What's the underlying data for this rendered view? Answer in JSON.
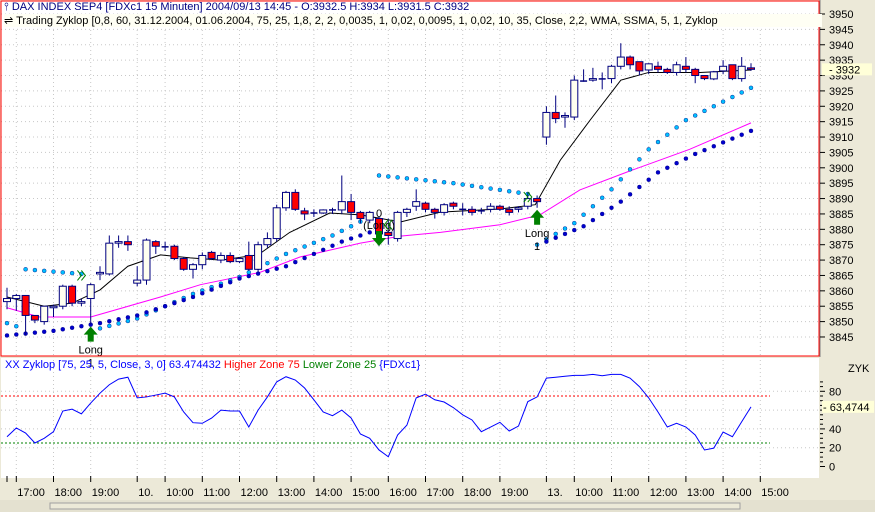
{
  "header": {
    "icon": "candlestick-icon",
    "symbol_line": "DAX INDEX SEP4   [FDXc1  15 Minuten] 2004/09/13 14:45 - O:3932.5 H:3934 L:3931.5 C:3932",
    "indicator_icon": "double-arrow-icon",
    "indicator_line": "Trading Zyklop [0,8, 60, 31.12.2004, 01.06.2004, 75, 25, 1,8, 2, 2, 0,0035, 1, 0,02, 0,0095, 1, 0,02, 10, 35, Close, 2,2, WMA, SSMA, 5, 1, Zyklop"
  },
  "oscillator_header": {
    "name": "XX Zyklop [75, 25, 5, Close, 3, 0] 63.474432",
    "higher": "Higher Zone 75",
    "lower": "Lower Zone 25",
    "symbol": "{FDXc1}"
  },
  "colors": {
    "bull": "#FFFFF0",
    "bear": "#FF0000",
    "outline": "#000080",
    "wma": "#000000",
    "ssma": "#FF00FF",
    "dot_light": "#00BFFF",
    "dot_dark": "#0000CC",
    "signal": "#008000",
    "osc": "#0000FF",
    "grid": "#C8C8C8",
    "frame": "#FF0000"
  },
  "chart_data": [
    {
      "type": "candlestick",
      "title": "DAX INDEX SEP4 [FDXc1 15 Minuten]",
      "ylim": [
        3842,
        3952
      ],
      "y_ticks": [
        3950,
        3945,
        3940,
        3935,
        3930,
        3925,
        3920,
        3915,
        3910,
        3905,
        3900,
        3895,
        3890,
        3885,
        3880,
        3875,
        3870,
        3865,
        3860,
        3855,
        3850,
        3845
      ],
      "last_price": "3932",
      "ohlc": [
        [
          3856.5,
          3861,
          3854,
          3857.5
        ],
        [
          3857.5,
          3859,
          3853.5,
          3858.5
        ],
        [
          3858.5,
          3858.5,
          3845.5,
          3852
        ],
        [
          3852,
          3852,
          3849.5,
          3850.5
        ],
        [
          3850,
          3855,
          3849,
          3855
        ],
        [
          3854.5,
          3855.5,
          3851.5,
          3855
        ],
        [
          3855,
          3862,
          3854,
          3861.5
        ],
        [
          3861.5,
          3862,
          3855,
          3856
        ],
        [
          3856,
          3857.5,
          3855,
          3856.5
        ],
        [
          3857.5,
          3862.5,
          3849,
          3862
        ],
        [
          3865.5,
          3868,
          3863.5,
          3866
        ],
        [
          3865.5,
          3878,
          3865,
          3875.5
        ],
        [
          3875.5,
          3878,
          3874,
          3876
        ],
        [
          3876,
          3878,
          3873,
          3875
        ],
        [
          3862.5,
          3868,
          3861.5,
          3863.5
        ],
        [
          3863.5,
          3877,
          3862,
          3876.5
        ],
        [
          3876,
          3876.5,
          3872,
          3874.5
        ],
        [
          3874.3,
          3876,
          3873,
          3874.3
        ],
        [
          3874.5,
          3875,
          3870,
          3870.5
        ],
        [
          3870.5,
          3871,
          3866.5,
          3867
        ],
        [
          3867,
          3869,
          3864,
          3868.5
        ],
        [
          3868.5,
          3872.5,
          3867,
          3871.5
        ],
        [
          3872.5,
          3873,
          3870,
          3870.5
        ],
        [
          3870,
          3872.5,
          3869,
          3871.5
        ],
        [
          3871.5,
          3872.5,
          3869,
          3869.5
        ],
        [
          3869.5,
          3871,
          3869,
          3870.5
        ],
        [
          3871.5,
          3876,
          3866.5,
          3867
        ],
        [
          3867,
          3876,
          3866,
          3875
        ],
        [
          3875,
          3879,
          3874,
          3877
        ],
        [
          3877,
          3888,
          3876,
          3887
        ],
        [
          3887,
          3892.5,
          3886,
          3892
        ],
        [
          3892,
          3893,
          3886,
          3886.5
        ],
        [
          3886,
          3887,
          3883,
          3885
        ],
        [
          3885.3,
          3886.5,
          3884,
          3885.3
        ],
        [
          3885.3,
          3886.5,
          3885,
          3886.3
        ],
        [
          3886.3,
          3887,
          3885,
          3886.3
        ],
        [
          3886.3,
          3897.5,
          3885,
          3889
        ],
        [
          3889,
          3891.5,
          3883,
          3885.5
        ],
        [
          3885.5,
          3886,
          3882,
          3883.5
        ],
        [
          3883,
          3886,
          3882,
          3885.5
        ],
        [
          3883.5,
          3884,
          3874.5,
          3878.5
        ],
        [
          3879,
          3883.5,
          3875,
          3878
        ],
        [
          3877,
          3886,
          3876,
          3885.5
        ],
        [
          3885.5,
          3887,
          3884,
          3886.5
        ],
        [
          3887.5,
          3893,
          3886,
          3889
        ],
        [
          3888.5,
          3889,
          3885.5,
          3886.5
        ],
        [
          3886.5,
          3887,
          3883.5,
          3885.5
        ],
        [
          3885.5,
          3888.5,
          3884.5,
          3888
        ],
        [
          3888.5,
          3889,
          3886.5,
          3887.5
        ],
        [
          3886.5,
          3888.5,
          3884.5,
          3886.5
        ],
        [
          3886.5,
          3887.5,
          3884.5,
          3885.5
        ],
        [
          3886,
          3887,
          3885,
          3886
        ],
        [
          3886.5,
          3888.5,
          3885.5,
          3887.5
        ],
        [
          3887.5,
          3888,
          3886,
          3886.5
        ],
        [
          3886.5,
          3887.5,
          3884.5,
          3885.5
        ],
        [
          3886.5,
          3887.5,
          3885.5,
          3887
        ],
        [
          3887.5,
          3892,
          3886.5,
          3890
        ],
        [
          3890,
          3891,
          3887,
          3889
        ],
        [
          3910,
          3920,
          3907.5,
          3918
        ],
        [
          3918,
          3923.5,
          3914.5,
          3916
        ],
        [
          3916.5,
          3918,
          3913,
          3917
        ],
        [
          3916.5,
          3930,
          3915.5,
          3928.5
        ],
        [
          3928.2,
          3932,
          3928,
          3928.2
        ],
        [
          3928.5,
          3932.5,
          3928,
          3929
        ],
        [
          3928.9,
          3931,
          3925.5,
          3928.9
        ],
        [
          3929,
          3933.5,
          3927.5,
          3933
        ],
        [
          3933,
          3940.5,
          3932,
          3936
        ],
        [
          3936,
          3936.5,
          3932,
          3933.5
        ],
        [
          3934.5,
          3934.5,
          3930,
          3931.5
        ],
        [
          3931.8,
          3934,
          3930.5,
          3933.8
        ],
        [
          3933,
          3934.5,
          3931,
          3932
        ],
        [
          3932,
          3932.5,
          3930.5,
          3931
        ],
        [
          3931,
          3934.5,
          3930,
          3933.5
        ],
        [
          3933,
          3936,
          3931,
          3932
        ],
        [
          3932,
          3932.5,
          3927.5,
          3930
        ],
        [
          3930,
          3930,
          3928.5,
          3929
        ],
        [
          3928.9,
          3931.5,
          3928.5,
          3931.2
        ],
        [
          3931.5,
          3935,
          3930.5,
          3933
        ],
        [
          3933.5,
          3933.5,
          3928.5,
          3929
        ],
        [
          3929,
          3936,
          3928,
          3933
        ],
        [
          3932.5,
          3934,
          3931.5,
          3932
        ]
      ],
      "wma_line": [
        [
          0,
          3858
        ],
        [
          4,
          3855
        ],
        [
          7,
          3856
        ],
        [
          10,
          3860.3
        ],
        [
          13,
          3868
        ],
        [
          16.5,
          3871.7
        ],
        [
          19.7,
          3870.7
        ],
        [
          23,
          3870
        ],
        [
          27,
          3871.7
        ],
        [
          30.4,
          3879
        ],
        [
          34.7,
          3885.3
        ],
        [
          38,
          3884.7
        ],
        [
          42.3,
          3882.4
        ],
        [
          46.6,
          3885.6
        ],
        [
          53,
          3886.6
        ],
        [
          56.8,
          3888
        ],
        [
          59.5,
          3902.5
        ],
        [
          62.7,
          3915.5
        ],
        [
          66,
          3928.5
        ],
        [
          69,
          3931
        ],
        [
          74.5,
          3931
        ],
        [
          80,
          3931.8
        ]
      ],
      "ssma_line": [
        [
          0,
          3854.5
        ],
        [
          3.5,
          3851.5
        ],
        [
          9,
          3851.5
        ],
        [
          16.5,
          3858
        ],
        [
          20.8,
          3862
        ],
        [
          27.2,
          3866
        ],
        [
          31.5,
          3871
        ],
        [
          38,
          3875.5
        ],
        [
          42.3,
          3877.8
        ],
        [
          46.6,
          3879
        ],
        [
          53,
          3881.5
        ],
        [
          57.3,
          3884.7
        ],
        [
          61.6,
          3892.8
        ],
        [
          67,
          3899
        ],
        [
          73.4,
          3906
        ],
        [
          80,
          3914.6
        ]
      ],
      "stop_light": [
        [
          [
            0,
            3849.5
          ],
          [
            1,
            3848.5
          ]
        ],
        [
          [
            2,
            3867
          ],
          [
            8,
            3865.5
          ]
        ],
        [
          [
            9,
            3847
          ],
          [
            14,
            3851
          ],
          [
            20,
            3859
          ],
          [
            25,
            3864.5
          ],
          [
            30,
            3872
          ],
          [
            35,
            3878
          ],
          [
            39,
            3884
          ]
        ],
        [
          [
            40,
            3897.5
          ],
          [
            48,
            3895
          ],
          [
            56,
            3891.5
          ]
        ],
        [
          [
            57,
            3875
          ],
          [
            61,
            3882
          ],
          [
            65,
            3893
          ],
          [
            69,
            3906
          ],
          [
            73,
            3915.5
          ],
          [
            77,
            3921.5
          ],
          [
            80,
            3926
          ]
        ]
      ],
      "stop_dark": [
        [
          [
            0,
            3845.5
          ],
          [
            5,
            3847
          ],
          [
            10,
            3849.5
          ],
          [
            14,
            3852
          ],
          [
            20,
            3858
          ],
          [
            25,
            3864
          ],
          [
            30,
            3868
          ],
          [
            33,
            3872
          ],
          [
            36,
            3876
          ],
          [
            39,
            3879
          ]
        ],
        [
          [
            58,
            3876
          ],
          [
            62,
            3881
          ],
          [
            66,
            3889
          ],
          [
            70,
            3898.5
          ],
          [
            74,
            3904.5
          ],
          [
            78,
            3909.5
          ],
          [
            80,
            3912
          ]
        ]
      ],
      "signals": [
        {
          "bar": 9,
          "direction": "up",
          "label": "Long",
          "count": "1"
        },
        {
          "bar": 40,
          "direction": "down",
          "label": "(Long)",
          "count": "0"
        },
        {
          "bar": 57,
          "direction": "up",
          "label": "Long",
          "count": "1"
        }
      ],
      "chevrons": [
        {
          "bar": 8,
          "price": 3865,
          "dir": "right"
        },
        {
          "bar": 41,
          "price": 3881.5,
          "dir": "left"
        },
        {
          "bar": 56,
          "price": 3890.5,
          "dir": "right"
        }
      ]
    },
    {
      "type": "line",
      "title": "XX Zyklop",
      "axis_label": "ZYK",
      "ylim": [
        0,
        100
      ],
      "y_ticks": [
        80,
        40,
        20,
        0
      ],
      "last_value": "63,4744",
      "higher_zone": 75,
      "lower_zone": 25,
      "values": [
        31.7,
        41,
        35.6,
        25,
        30,
        37,
        59,
        61,
        56,
        67.5,
        78,
        87,
        93,
        95,
        73,
        74,
        76,
        78,
        74,
        58,
        46.6,
        46,
        51.5,
        60,
        59,
        59,
        42,
        60,
        74,
        90,
        95.5,
        92,
        83.5,
        71,
        58,
        54,
        60,
        51.6,
        34.6,
        30,
        17.6,
        10.4,
        33.5,
        44,
        73,
        77,
        71,
        68.6,
        62.6,
        55,
        49.5,
        37,
        42,
        47,
        37.8,
        43,
        69,
        74,
        94,
        95,
        96,
        97,
        97,
        98,
        96.6,
        98,
        98,
        94,
        85,
        73,
        58,
        42,
        46,
        42,
        33.5,
        17.6,
        19.5,
        36.7,
        31.7,
        47.6,
        63.47
      ]
    }
  ],
  "time_axis": [
    {
      "label": "",
      "bar": 0
    },
    {
      "label": "17:00",
      "bar": 1
    },
    {
      "label": "18:00",
      "bar": 5
    },
    {
      "label": "19:00",
      "bar": 9
    },
    {
      "label": "10.",
      "bar": 14
    },
    {
      "label": "10:00",
      "bar": 17
    },
    {
      "label": "11:00",
      "bar": 21
    },
    {
      "label": "12:00",
      "bar": 25
    },
    {
      "label": "13:00",
      "bar": 29
    },
    {
      "label": "14:00",
      "bar": 33
    },
    {
      "label": "15:00",
      "bar": 37
    },
    {
      "label": "16:00",
      "bar": 41
    },
    {
      "label": "17:00",
      "bar": 45
    },
    {
      "label": "18:00",
      "bar": 49
    },
    {
      "label": "19:00",
      "bar": 53
    },
    {
      "label": "13.",
      "bar": 58
    },
    {
      "label": "10:00",
      "bar": 61
    },
    {
      "label": "11:00",
      "bar": 65
    },
    {
      "label": "12:00",
      "bar": 69
    },
    {
      "label": "13:00",
      "bar": 73
    },
    {
      "label": "14:00",
      "bar": 77
    },
    {
      "label": "15:00",
      "bar": 81
    }
  ]
}
